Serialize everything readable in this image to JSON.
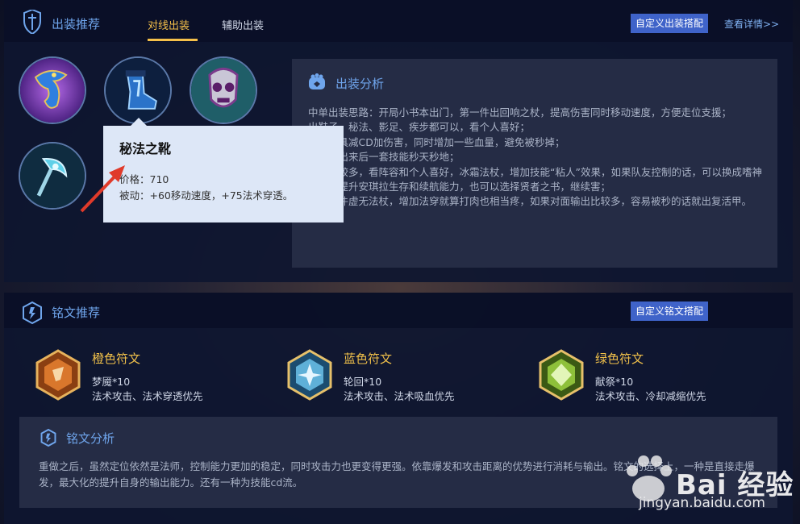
{
  "header": {
    "title": "出装推荐",
    "tabs": [
      {
        "label": "对线出装",
        "active": true
      },
      {
        "label": "辅助出装",
        "active": false
      }
    ],
    "custom_button": "自定义出装搭配",
    "details_link": "查看详情>>"
  },
  "items": [
    {
      "icon": "dragon-staff-icon"
    },
    {
      "icon": "arcane-boots-icon"
    },
    {
      "icon": "skull-mask-icon"
    },
    {
      "icon": "crescent-scepter-icon"
    }
  ],
  "tooltip": {
    "name": "秘法之靴",
    "price": "价格：710",
    "passive": "被动：+60移动速度，+75法术穿透。"
  },
  "analysis": {
    "title": "出装分析",
    "lines": [
      "中单出装思路：开局小书本出门，第一件出回响之杖，提高伤害同时移动速度，方便走位支援；",
      "出鞋子，秘法、影足、疾步都可以，看个人喜好；",
      "痛苦面具减CD加伤害，同时增加一些血量，避免被秒掉；",
      "帽子，出来后一套技能秒天秒地；",
      "选择比较多，看阵容和个人喜好，冰霜法杖，增加技能“粘人”效果，如果队友控制的话，可以换成嗜神之书，提升安琪拉生存和续航能力，也可以选择贤者之书，继续害；",
      "最后一件虚无法杖，增加法穿就算打肉也相当疼，如果对面输出比较多，容易被秒的话就出复活甲。"
    ]
  },
  "runes": {
    "title": "铭文推荐",
    "custom_button": "自定义铭文搭配",
    "items": [
      {
        "title": "橙色符文",
        "count": "梦魇*10",
        "desc": "法术攻击、法术穿透优先",
        "color": "#d9772c"
      },
      {
        "title": "蓝色符文",
        "count": "轮回*10",
        "desc": "法术攻击、法术吸血优先",
        "color": "#5fb0d8"
      },
      {
        "title": "绿色符文",
        "count": "献祭*10",
        "desc": "法术攻击、冷却减缩优先",
        "color": "#8ec03a"
      }
    ]
  },
  "rune_analysis": {
    "title": "铭文分析",
    "text": "重做之后，虽然定位依然是法师，控制能力更加的稳定，同时攻击力也更变得更强。依靠爆发和攻击距离的优势进行消耗与输出。铭文的选择上，一种是直接走爆发，最大化的提升自身的输出能力。还有一种为技能cd流。"
  },
  "watermark": {
    "text": "Bai 经验",
    "url": "jingyan.baidu.com"
  }
}
